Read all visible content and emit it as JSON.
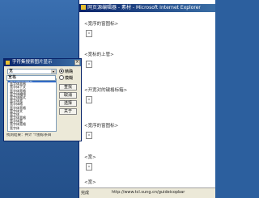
{
  "ie_window": {
    "title": "网页源编辑器 - 素材 - Microsoft Internet Explorer",
    "sections": [
      {
        "label": "<宽序的窗图标>"
      },
      {
        "label": "<宽标的上管>"
      },
      {
        "label": "<开宽对的键格标箱>"
      },
      {
        "label": "<宽序的窗图标>"
      },
      {
        "label": "<宽>"
      },
      {
        "label": "<宽>"
      }
    ],
    "status_left": "完成",
    "status_url": "http://www.tcl.sung.cn/guideicopbar"
  },
  "dialog": {
    "title": "字符集搜索图片显示",
    "close": "×",
    "combo1_value": "宽",
    "combo2_value": "宽格",
    "radio_options": [
      {
        "label": "精确",
        "selected": true
      },
      {
        "label": "模糊",
        "selected": false
      }
    ],
    "buttons": [
      "查找",
      "取消",
      "选择",
      "关于"
    ],
    "list_items": [
      "宽字体自然格式",
      "宽字体宽格",
      "宽字体下文",
      "宽字体宽格",
      "宽字体编排",
      "宽字体格式",
      "宽字体宽",
      "宽字体格",
      "宽字体宽格",
      "宽字体文",
      "宽字体",
      "宽字体宽格",
      "宽字体宽",
      "宽字体宽格",
      "宽字体"
    ],
    "selected_index": 0,
    "status_text": "找到结果：共计 个图标条目"
  }
}
